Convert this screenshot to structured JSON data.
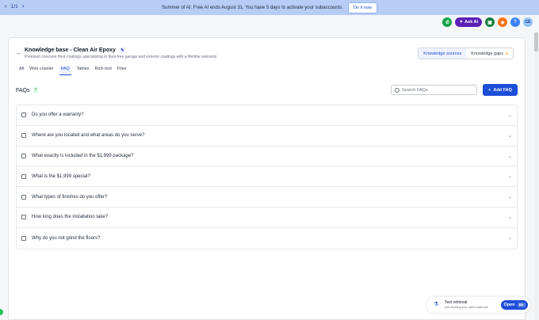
{
  "banner": {
    "pager": "1/1",
    "message": "Summer of AI: Free AI ends August 31. You have 5 days to activate your subaccounts.",
    "cta": "Do it now"
  },
  "header": {
    "ask_ai": "Ask AI",
    "avatar_initials": "CE"
  },
  "kb": {
    "title": "Knowledge base - Clean Air Epoxy",
    "description": "Premium concrete floor coatings specializing in dust-free garage and exterior coatings with a lifetime warranty.",
    "segments": [
      "Knowledge sources",
      "Knowledge gaps"
    ],
    "active_segment": "Knowledge sources"
  },
  "tabs": [
    {
      "label": "All",
      "active": false
    },
    {
      "label": "Web crawler",
      "active": false
    },
    {
      "label": "FAQ",
      "active": true
    },
    {
      "label": "Tables",
      "active": false
    },
    {
      "label": "Rich text",
      "active": false
    },
    {
      "label": "Files",
      "active": false
    }
  ],
  "faqs": {
    "heading": "FAQs",
    "count": "7",
    "search_placeholder": "Search FAQs",
    "add_label": "Add FAQ",
    "items": [
      "Do you offer a warranty?",
      "Where are you located and what areas do you serve?",
      "What exactly is included in the $1,999 package?",
      "What is the $1,999 special?",
      "What types of finishes do you offer?",
      "How long does the installation take?",
      "Why do you not grind the floors?"
    ]
  },
  "widget": {
    "title": "Test retrieval",
    "subtitle": "Ask anything your users might ask",
    "open_label": "Open",
    "shortcut": "⌘K"
  },
  "colors": {
    "accent": "#1d4ed8",
    "banner": "#b7cdf6",
    "ask_ai": "#5b21b6"
  },
  "icons": [
    "back-arrow-icon",
    "edit-icon",
    "search-icon",
    "plus-icon",
    "chevron-down-icon",
    "phone-icon",
    "bell-icon",
    "help-icon"
  ]
}
